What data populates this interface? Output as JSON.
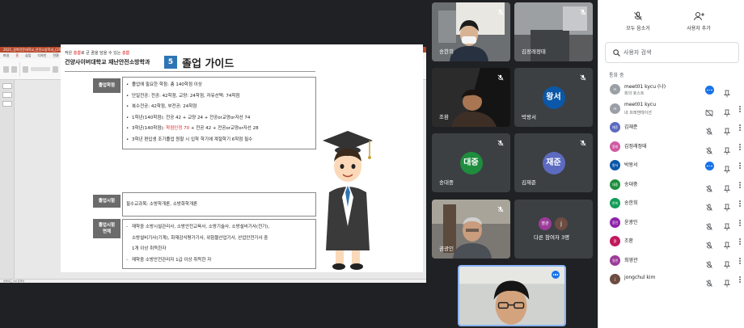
{
  "ppt": {
    "window_title": "2021_경북전문대학교_안전소방학과_(1학기_수업..._소방학과 박상(5).pptx  -  PowerPoint",
    "tabs": [
      "파일",
      "홈",
      "삽입",
      "디자인",
      "전환",
      "애니메이션",
      "슬라이드 쇼",
      "검토",
      "보기",
      "도움말",
      "ACROBAT"
    ],
    "status": "슬라이드 3/9   한국어"
  },
  "slide": {
    "subtitle_pre": "작은 ",
    "subtitle_red1": "흥쁨",
    "subtitle_mid": "로 큰 꿈을 담을 수 있는 ",
    "subtitle_red2": "흥쁨",
    "school": "건양사이버대학교 재난안전소방학과",
    "section_number": "5",
    "section_title": "졸업 가이드",
    "sections": [
      {
        "label": "졸업학점",
        "items": [
          {
            "text": "졸업에 필요한 학점: 총 140학점 이상"
          },
          {
            "text": "단일전공: 전공: 42학점, 교양: 24학점, 자유선택: 74학점"
          },
          {
            "text": "복수전공: 42학점, 부전공: 24학점"
          },
          {
            "text": "1학년(140학점): 전공 42 + 교양 24 + 전공or교양or자선 74"
          },
          {
            "pre": "3학년(140학점): ",
            "red": "학점인정 70",
            "post": " + 전공 42 + 전공or교양or자선 28"
          },
          {
            "text": "3학년 편입생 조기졸업 원할 시 입학 학기에 계절학기 6학점 필수"
          }
        ]
      },
      {
        "label": "졸업시험",
        "items": [
          {
            "text": "필수교과목: 소방학개론, 소방화학개론"
          }
        ]
      },
      {
        "label": "졸업시험 면제",
        "items": [
          {
            "text": "재학중 소방시설관리사, 소방안전교육사, 소방기술사, 소방설비기사(전기),"
          },
          {
            "text": "소방설비기사(기계), 화재감식평가기사, 위험물산업기사, 산업안전기사 중"
          },
          {
            "text": "1개 이상 취득한자"
          },
          {
            "text": "재학중 소방안전관리자 1급 이상 취득한 자"
          }
        ]
      }
    ]
  },
  "tiles": [
    {
      "name": "송한희",
      "type": "video",
      "muted": true
    },
    {
      "name": "김정래정태",
      "type": "video",
      "muted": true
    },
    {
      "name": "조환",
      "type": "video",
      "muted": true
    },
    {
      "name": "박왕서",
      "type": "avatar",
      "initial": "왕서",
      "color": "#0b57a8",
      "muted": true
    },
    {
      "name": "송대중",
      "type": "avatar",
      "initial": "대중",
      "color": "#1e8e3e",
      "muted": true
    },
    {
      "name": "김재준",
      "type": "avatar",
      "initial": "재준",
      "color": "#5c6bc0",
      "muted": true
    },
    {
      "name": "권광인",
      "type": "video",
      "muted": true
    },
    {
      "name": "다른 참여자 3명",
      "type": "others",
      "avatars": [
        {
          "t": "영관",
          "c": "#9c3b9a"
        },
        {
          "t": "j",
          "c": "#6d4c41"
        }
      ]
    },
    {
      "name": "",
      "type": "self",
      "muted": false
    }
  ],
  "panel": {
    "mute_all": "모두 음소거",
    "add_people": "사용자 추가",
    "search_placeholder": "사용자 검색",
    "in_call": "통화 중",
    "people": [
      {
        "name": "meet01 kycu (나)",
        "sub": "회의 호스트",
        "avatar": "m",
        "color": "#9aa0a6",
        "kind": "host"
      },
      {
        "name": "meet01 kycu",
        "sub": "내 프레젠테이션",
        "avatar": "m",
        "color": "#9aa0a6",
        "kind": "presentation"
      },
      {
        "name": "김재준",
        "avatar": "재준",
        "color": "#5c6bc0",
        "kind": "muted"
      },
      {
        "name": "김정래정태",
        "avatar": "정태",
        "color": "#d05aa3",
        "kind": "muted"
      },
      {
        "name": "박왕서",
        "avatar": "왕서",
        "color": "#0b57a8",
        "kind": "speaking"
      },
      {
        "name": "송대중",
        "avatar": "대중",
        "color": "#1e8e3e",
        "kind": "muted"
      },
      {
        "name": "송한희",
        "avatar": "한희",
        "color": "#0f9d58",
        "kind": "muted"
      },
      {
        "name": "윤광인",
        "avatar": "광인",
        "color": "#8e24aa",
        "kind": "muted"
      },
      {
        "name": "조환",
        "avatar": "환",
        "color": "#c2185b",
        "kind": "muted"
      },
      {
        "name": "최영관",
        "avatar": "영관",
        "color": "#9c3b9a",
        "kind": "muted"
      },
      {
        "name": "jongchul kim",
        "avatar": "j",
        "color": "#6d4c41",
        "kind": "muted"
      }
    ]
  }
}
